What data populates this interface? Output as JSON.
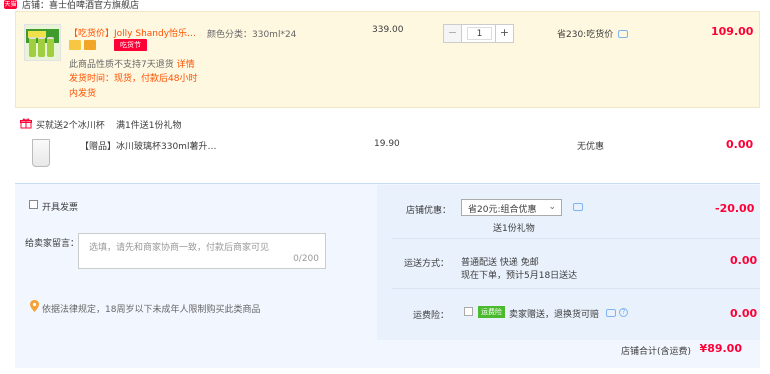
{
  "store": {
    "badge": "天猫",
    "name": "店铺：喜士伯啤酒官方旗舰店"
  },
  "item": {
    "title_tag": "【吃货价】",
    "title": "Jolly Shandy怡乐…",
    "promo_button": "吃货节",
    "notice_line1_prefix": "此商品性质不支持7天退货",
    "notice_line1_link": "详情",
    "notice_line2": "发货时间：现货，付款后48小时",
    "notice_line3": "内发货",
    "spec": "颜色分类：330ml*24",
    "unit_price": "339.00",
    "quantity": "1",
    "minus": "−",
    "plus": "+",
    "discount": "省230:吃货价",
    "subtotal": "109.00"
  },
  "gift_promo": {
    "text": "买就送2个冰川杯",
    "rule": "满1件送1份礼物"
  },
  "gift_item": {
    "title": "【赠品】冰川玻璃杯330ml薯升…",
    "price": "19.90",
    "discount": "无优惠",
    "subtotal": "0.00"
  },
  "order": {
    "anonymous_label": "开具发票",
    "message_label": "给卖家留言：",
    "message_placeholder": "选填，请先和商家协商一致，付款后商家可见",
    "message_count": "0/200",
    "legal_notice": "依据法律规定，18周岁以下未成年人限制购买此类商品",
    "store_discount_label": "店铺优惠：",
    "store_discount_select": "省20元:组合优惠",
    "store_discount_gift": "送1份礼物",
    "store_discount_value": "-20.00",
    "shipping_label": "运送方式：",
    "shipping_method": "普通配送 快递 免邮",
    "shipping_eta": "现在下单，预计5月18日送达",
    "shipping_value": "0.00",
    "insurance_label": "运费险：",
    "insurance_tag": "运费险",
    "insurance_text": "卖家赠送，退换货可赔",
    "insurance_value": "0.00",
    "total_label": "店铺合计(含运费)",
    "total_value": "¥89.00"
  }
}
